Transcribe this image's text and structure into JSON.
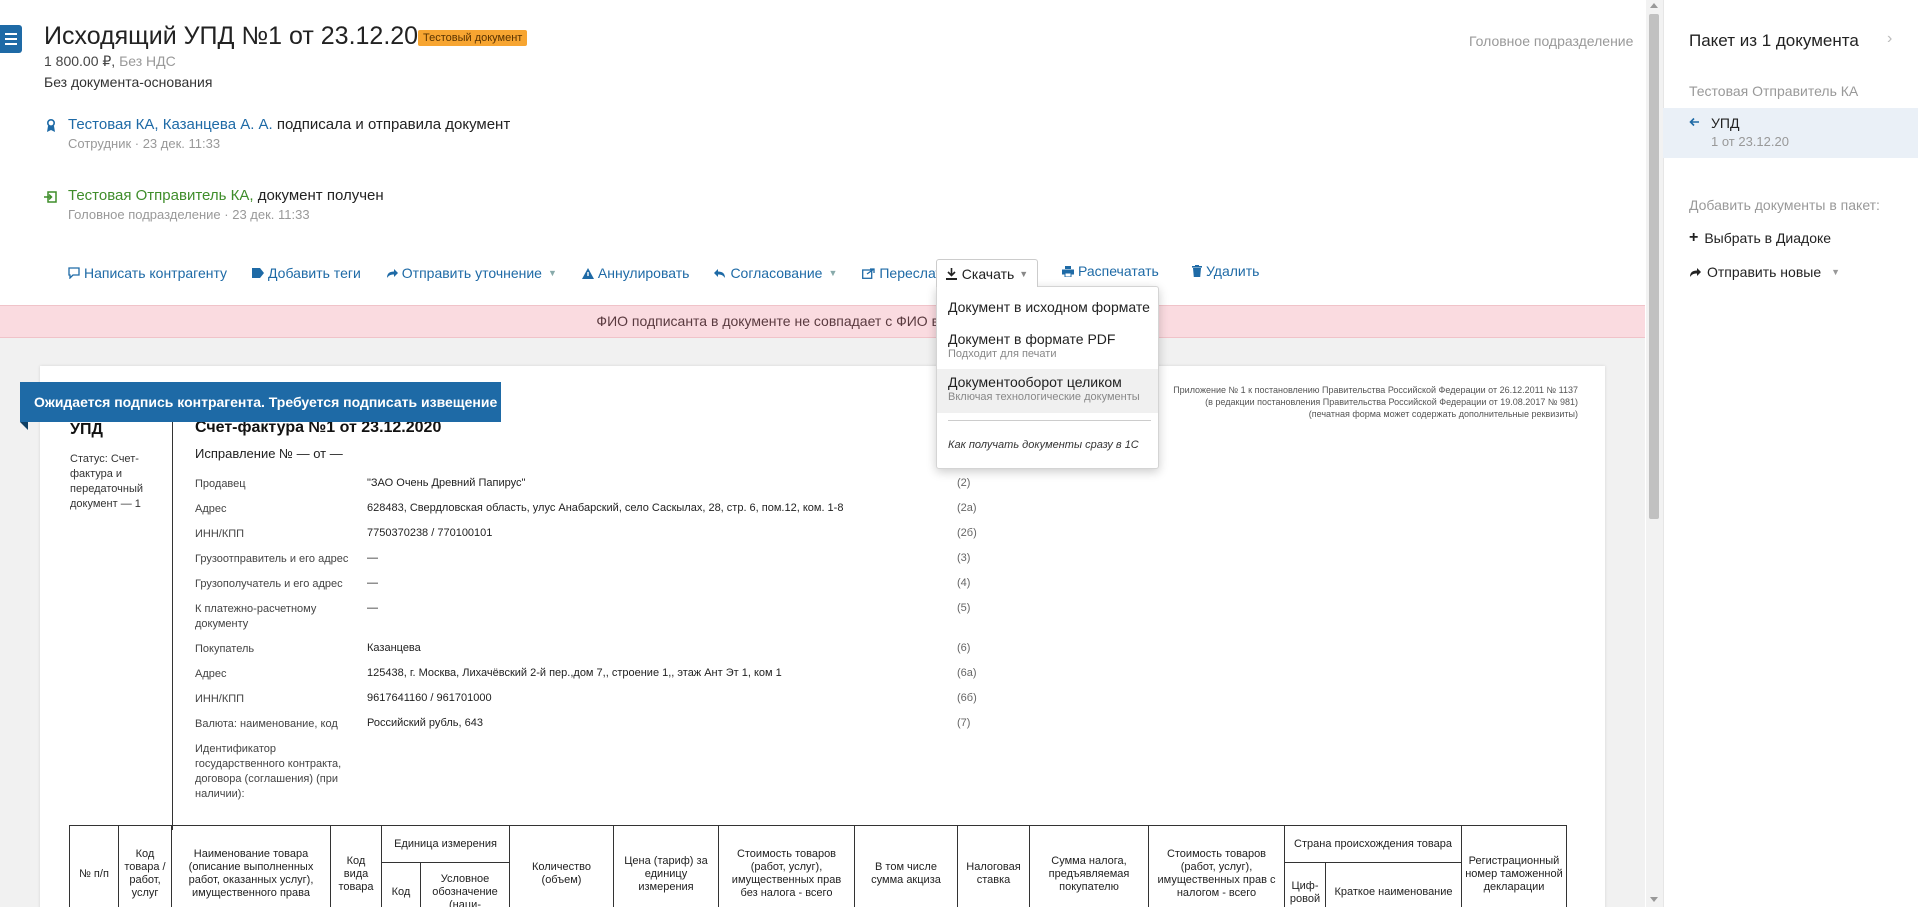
{
  "header": {
    "title": "Исходящий УПД №1 от 23.12.20",
    "badge": "Тестовый документ",
    "amount": "1 800.00 ₽,",
    "vat": "Без НДС",
    "basis": "Без документа-основания",
    "department": "Головное подразделение"
  },
  "events": [
    {
      "who": "Тестовая КА, Казанцева А. А.",
      "action": "подписала и отправила документ",
      "meta": "Сотрудник · 23 дек. 11:33"
    },
    {
      "who": "Тестовая Отправитель КА,",
      "action": "документ получен",
      "meta": "Головное подразделение · 23 дек. 11:33"
    }
  ],
  "toolbar": {
    "write": "Написать контрагенту",
    "tags": "Добавить теги",
    "clarify": "Отправить уточнение",
    "annul": "Аннулировать",
    "approval": "Согласование",
    "forward": "Переслать",
    "download": "Скачать",
    "print": "Распечатать",
    "delete": "Удалить"
  },
  "download_menu": {
    "items": [
      {
        "title": "Документ в исходном формате",
        "sub": ""
      },
      {
        "title": "Документ в формате PDF",
        "sub": "Подходит для печати"
      },
      {
        "title": "Документооборот целиком",
        "sub": "Включая технологические документы"
      }
    ],
    "hint": "Как получать документы сразу в 1С"
  },
  "warning": "ФИО подписанта в документе не совпадает с ФИО владельца электр",
  "document": {
    "ribbon": "Ожидается подпись контрагента. Требуется подписать извещение",
    "type": "УПД",
    "status": "Статус: Счет-фактура и передаточный документ — 1",
    "invoice_title": "Счет-фактура №1 от 23.12.2020",
    "correction": "Исправление № — от —",
    "appendix_1": "Приложение № 1 к постановлению Правительства Российской Федерации от 26.12.2011 № 1137",
    "appendix_2": "(в редакции постановления Правительства Российской Федерации от 19.08.2017 № 981)",
    "appendix_3": "(печатная форма может содержать дополнительные реквизиты)",
    "fields": [
      {
        "label": "Продавец",
        "value": "\"ЗАО Очень Древний Папирус\"",
        "code": "(2)"
      },
      {
        "label": "Адрес",
        "value": "628483, Свердловская область, улус Анабарский, село Саскылах, 28, стр. 6, пом.12, ком. 1-8",
        "code": "(2а)"
      },
      {
        "label": "ИНН/КПП",
        "value": "7750370238 / 770100101",
        "code": "(2б)"
      },
      {
        "label": "Грузоотправитель и его адрес",
        "value": "—",
        "code": "(3)"
      },
      {
        "label": "Грузополучатель и его адрес",
        "value": "—",
        "code": "(4)"
      },
      {
        "label": "К платежно-расчетному документу",
        "value": "—",
        "code": "(5)"
      },
      {
        "label": "Покупатель",
        "value": "Казанцева",
        "code": "(6)"
      },
      {
        "label": "Адрес",
        "value": "125438, г. Москва, Лихачёвский 2-й пер.,дом 7,, строение 1,, этаж Ант Эт 1, ком 1",
        "code": "(6а)"
      },
      {
        "label": "ИНН/КПП",
        "value": "9617641160 / 961701000",
        "code": "(6б)"
      },
      {
        "label": "Валюта: наименование, код",
        "value": "Российский рубль, 643",
        "code": "(7)"
      },
      {
        "label": "Идентификатор государственного контракта, договора (соглашения) (при наличии):",
        "value": "",
        "code": ""
      }
    ],
    "table_headers": {
      "num": "№ п/п",
      "code": "Код товара / работ, услуг",
      "name": "Наименование товара (описание выполненных работ, оказанных услуг), имущественного права",
      "type_code": "Код вида товара",
      "unit": "Единица измерения",
      "unit_code": "Код",
      "unit_name": "Условное обозначение (наци-",
      "qty": "Количество (объем)",
      "price": "Цена (тариф) за единицу измерения",
      "cost_no_tax": "Стоимость товаров (работ, услуг), имущественных прав без налога - всего",
      "excise": "В том числе сумма акциза",
      "tax_rate": "Налоговая ставка",
      "tax_sum": "Сумма налога, предъявляемая покупателю",
      "cost_with_tax": "Стоимость товаров (работ, услуг), имущественных прав с налогом - всего",
      "origin": "Страна происхождения товара",
      "origin_code": "Циф-ровой",
      "origin_name": "Краткое наименование",
      "customs": "Регистрационный номер таможенной декларации"
    }
  },
  "package": {
    "title": "Пакет из 1 документа",
    "sender": "Тестовая Отправитель КА",
    "doc_name": "УПД",
    "doc_date": "1 от 23.12.20",
    "add_label": "Добавить документы в пакет:",
    "choose": "Выбрать в Диадоке",
    "send_new": "Отправить новые"
  },
  "colors": {
    "accent": "#1e6aa6",
    "badge": "#f7a531",
    "warning_bg": "#fadbe0",
    "received_green": "#3f8d2a"
  }
}
